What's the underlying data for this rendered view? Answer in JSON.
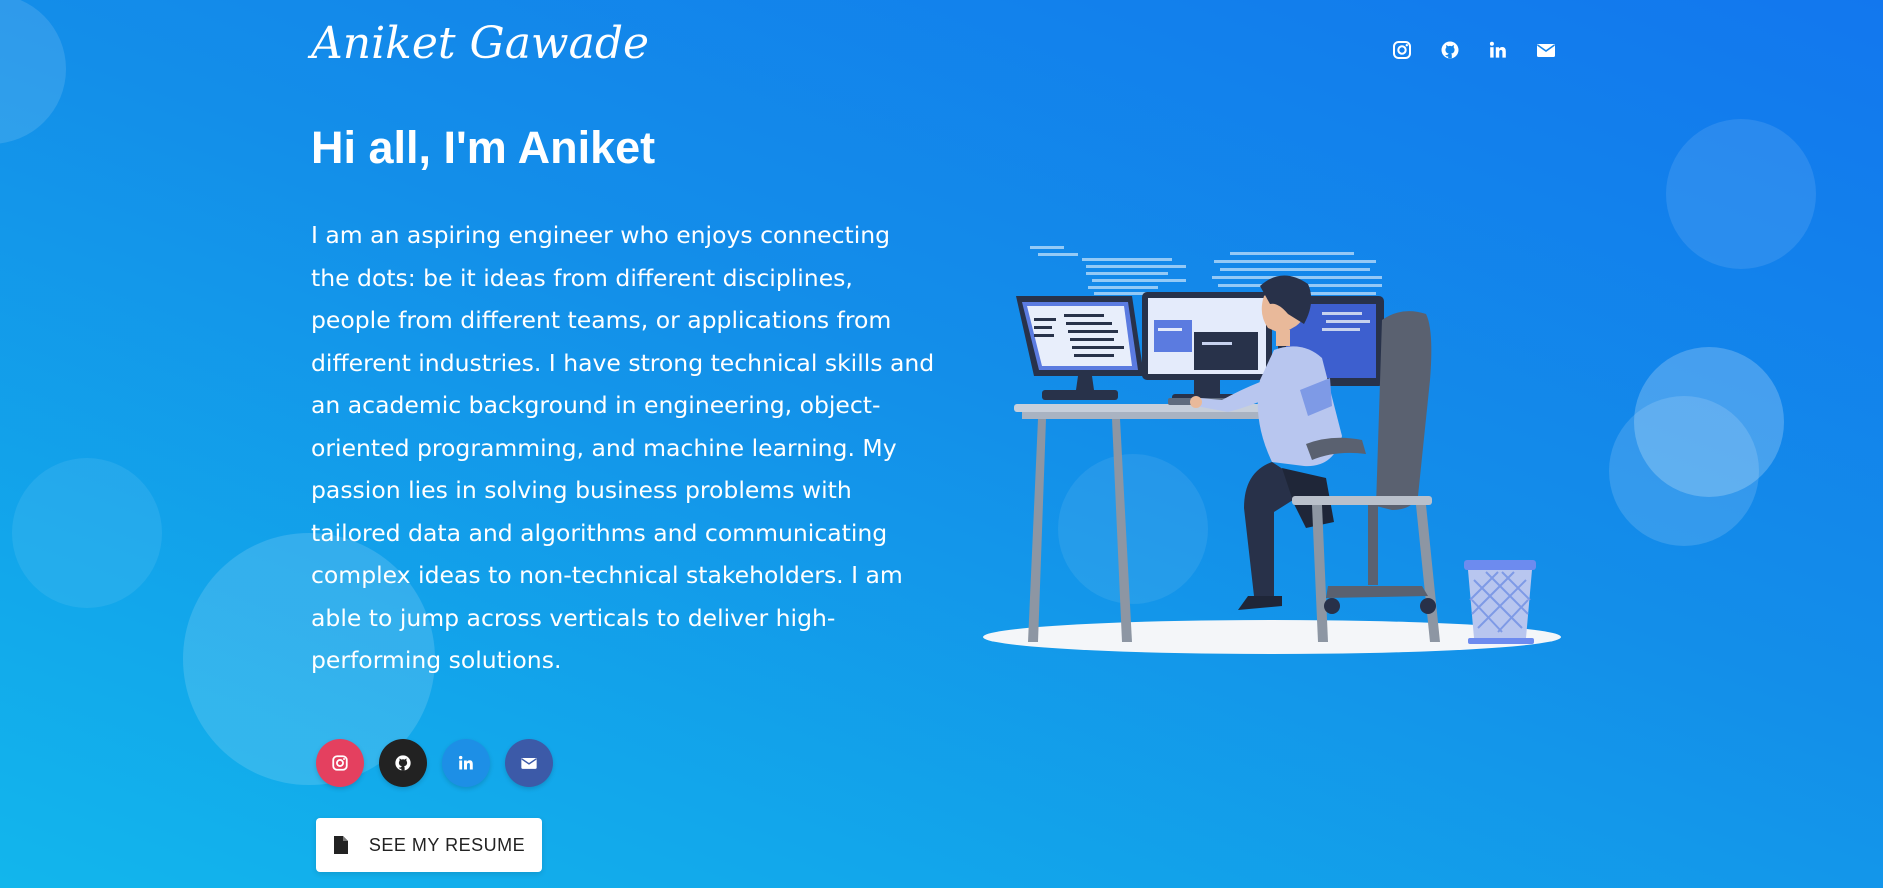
{
  "header": {
    "logo_text": "Aniket Gawade",
    "icons": [
      "instagram-icon",
      "github-icon",
      "linkedin-icon",
      "mail-icon"
    ]
  },
  "hero": {
    "greeting": "Hi all, I'm Aniket",
    "bio": "I am an aspiring engineer who enjoys connecting the dots: be it ideas from different disciplines, people from different teams, or applications from different industries. I have strong technical skills and an academic background in engineering, object-oriented programming, and machine learning. My passion lies in solving business problems with tailored data and algorithms and communicating complex ideas to non-technical stakeholders. I am able to jump across verticals to deliver high-performing solutions."
  },
  "social_buttons": [
    {
      "icon": "instagram-icon",
      "color": "#e4405f"
    },
    {
      "icon": "github-icon",
      "color": "#222222"
    },
    {
      "icon": "linkedin-icon",
      "color": "#1d8fe6"
    },
    {
      "icon": "mail-icon",
      "color": "#3c5aa8"
    }
  ],
  "resume_button": {
    "label": "SEE MY RESUME",
    "icon": "document-icon"
  },
  "colors": {
    "gradient_top": "#1277ee",
    "gradient_bottom": "#12b6ec",
    "text": "#ffffff"
  }
}
